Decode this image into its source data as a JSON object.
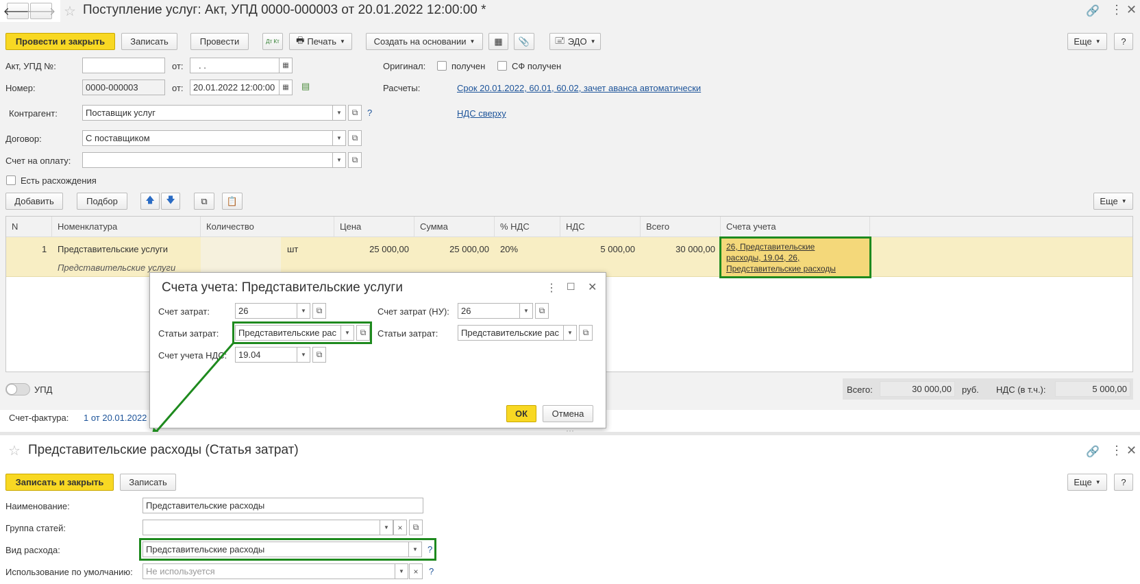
{
  "window": {
    "title": "Поступление услуг: Акт, УПД 0000-000003 от 20.01.2022 12:00:00 *"
  },
  "toolbar": {
    "post_close": "Провести и закрыть",
    "save": "Записать",
    "post": "Провести",
    "dtkt": "Дт Кт",
    "print": "Печать",
    "create_based": "Создать на основании",
    "edo": "ЭДО",
    "more": "Еще",
    "help": "?"
  },
  "header": {
    "act_label": "Акт, УПД №:",
    "act_value": "",
    "from_label": "от:",
    "act_date": ". .",
    "number_label": "Номер:",
    "number_value": "0000-000003",
    "number_date": "20.01.2022 12:00:00",
    "original_label": "Оригинал:",
    "received": "получен",
    "sf_received": "СФ получен",
    "settlements_label": "Расчеты:",
    "settlements_link": "Срок 20.01.2022, 60.01, 60.02, зачет аванса автоматически",
    "vat_link": "НДС сверху",
    "counterparty_label": "Контрагент:",
    "counterparty_value": "Поставщик услуг",
    "contract_label": "Договор:",
    "contract_value": "С поставщиком",
    "invoice_label": "Счет на оплату:",
    "invoice_value": "",
    "discrepancies": "Есть расхождения"
  },
  "table_toolbar": {
    "add": "Добавить",
    "select": "Подбор",
    "more": "Еще"
  },
  "table": {
    "columns": [
      "N",
      "Номенклатура",
      "Количество",
      "Цена",
      "Сумма",
      "% НДС",
      "НДС",
      "Всего",
      "Счета учета"
    ],
    "row": {
      "n": "1",
      "item": "Представительские услуги",
      "item_sub": "Представительские услуги",
      "unit": "шт",
      "price": "25 000,00",
      "sum": "25 000,00",
      "vat_rate": "20%",
      "vat": "5 000,00",
      "total": "30 000,00",
      "accounts_line1": "26, Представительские",
      "accounts_line2": "расходы, 19.04, 26,",
      "accounts_line3": "Представительские расходы"
    }
  },
  "footer": {
    "upd": "УПД",
    "total_label": "Всего:",
    "total_value": "30 000,00",
    "currency": "руб.",
    "vat_label": "НДС (в т.ч.):",
    "vat_value": "5 000,00",
    "invoice_label": "Счет-фактура:",
    "invoice_link": "1 от 20.01.2022"
  },
  "dialog": {
    "title": "Счета учета: Представительские услуги",
    "cost_account_label": "Счет затрат:",
    "cost_account_value": "26",
    "cost_account_nu_label": "Счет затрат (НУ):",
    "cost_account_nu_value": "26",
    "cost_item_label": "Статьи затрат:",
    "cost_item_value": "Представительские рас",
    "cost_item_nu_label": "Статьи затрат:",
    "cost_item_nu_value": "Представительские рас",
    "vat_account_label": "Счет учета НДС:",
    "vat_account_value": "19.04",
    "ok": "ОК",
    "cancel": "Отмена"
  },
  "bottom_form": {
    "title": "Представительские расходы (Статья затрат)",
    "save_close": "Записать и закрыть",
    "save": "Записать",
    "more": "Еще",
    "help": "?",
    "name_label": "Наименование:",
    "name_value": "Представительские расходы",
    "group_label": "Группа статей:",
    "group_value": "",
    "expense_type_label": "Вид расхода:",
    "expense_type_value": "Представительские расходы",
    "default_use_label": "Использование по умолчанию:",
    "default_use_placeholder": "Не используется"
  },
  "colors": {
    "accent_yellow": "#f8d823",
    "highlight_green": "#1e8a1e",
    "row_selected": "#f8eec4",
    "link_blue": "#1c5399"
  }
}
